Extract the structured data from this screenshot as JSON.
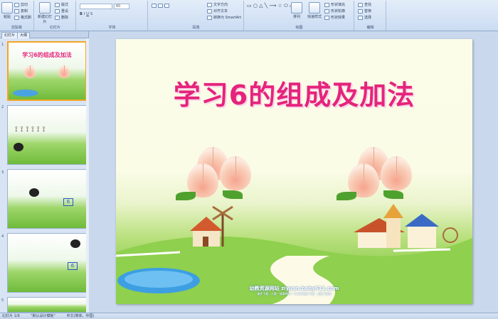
{
  "ribbon": {
    "clipboard": {
      "paste": "粘贴",
      "cut": "剪切",
      "copy": "复制",
      "format_painter": "格式刷",
      "label": "剪贴板"
    },
    "slides": {
      "new_slide": "新建幻灯片",
      "layout": "版式",
      "reset": "重设",
      "delete": "删除",
      "label": "幻灯片"
    },
    "font": {
      "font_name": "",
      "font_size": "60",
      "label": "字体"
    },
    "paragraph": {
      "text_direction": "文字方向",
      "align_text": "对齐文本",
      "smartart": "转换为 SmartArt",
      "label": "段落"
    },
    "drawing": {
      "arrange": "排列",
      "quick_styles": "快速样式",
      "shape_fill": "形状填充",
      "shape_outline": "形状轮廓",
      "shape_effects": "形状效果",
      "label": "绘图"
    },
    "editing": {
      "find": "查找",
      "replace": "替换",
      "select": "选择",
      "label": "编辑"
    }
  },
  "panel": {
    "tab_slides": "幻灯片",
    "tab_outline": "大纲",
    "thumb_numbers": [
      "1",
      "2",
      "3",
      "4",
      "5"
    ],
    "thumb1_title": "学习6的组成及加法",
    "thumb3_box": "6",
    "thumb4_box": "6"
  },
  "slide": {
    "title": "学习6的组成及加法",
    "watermark_title": "幼教资源网站  ziyuan.baby611.com",
    "watermark_sub": "课件下载 · 儿歌 · 故事MP3 · FLASH课件下载 · 试卷下载等"
  },
  "status": {
    "slide_pos": "幻灯片 1/9",
    "theme": "\"默认设计模板\"",
    "language": "中文(简体，中国)"
  },
  "colors": {
    "title": "#e5247c",
    "accent_selected": "#f5a623"
  }
}
